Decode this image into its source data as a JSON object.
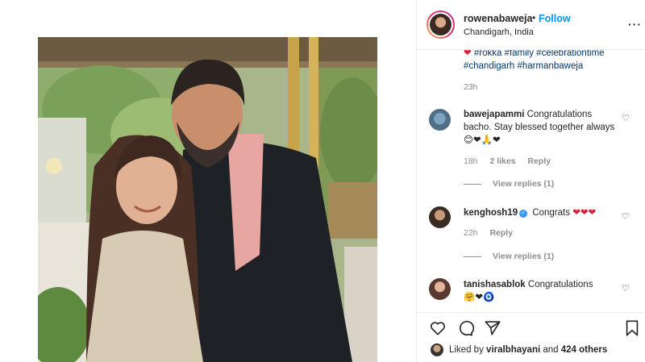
{
  "post": {
    "username": "rowenabaweja",
    "follow_label": "Follow",
    "dot": "•",
    "location": "Chandigarh, India",
    "more_label": "···"
  },
  "caption": {
    "line1": "#rokka #family #celebrationtime",
    "line2": "#chandigarh #harmanbaweja",
    "heart_emoji": "❤",
    "time": "23h"
  },
  "comments": [
    {
      "username": "bawejapammi",
      "text": "Congratulations bacho. Stay blessed together always",
      "emoji": "😊❤🙏❤",
      "time": "18h",
      "likes": "2 likes",
      "reply_label": "Reply",
      "view_replies": "View replies (1)"
    },
    {
      "username": "kenghosh19",
      "verified_mark": "✓",
      "text": "Congrats",
      "emoji": "❤❤❤",
      "time": "22h",
      "reply_label": "Reply",
      "view_replies": "View replies (1)"
    },
    {
      "username": "tanishasablok",
      "text": "Congratulations",
      "emoji": "🤗❤🧿"
    }
  ],
  "likes": {
    "prefix": "Liked by",
    "user": "viralbhayani",
    "and": "and",
    "others": "424 others"
  },
  "icons": {
    "heart": "heart-icon",
    "comment": "comment-icon",
    "share": "share-icon",
    "save": "bookmark-icon"
  },
  "colors": {
    "accent": "#0095f6",
    "muted": "#8e8e8e",
    "hashtag": "#00376b",
    "border": "#efefef"
  }
}
